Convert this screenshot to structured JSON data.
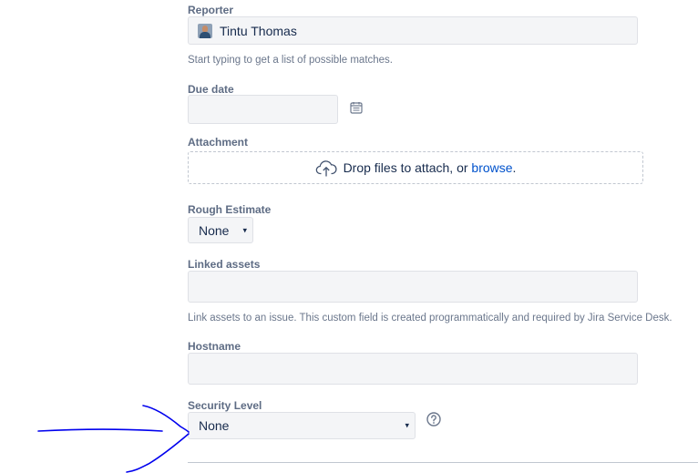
{
  "reporter": {
    "label": "Reporter",
    "value": "Tintu Thomas",
    "help": "Start typing to get a list of possible matches."
  },
  "due_date": {
    "label": "Due date",
    "value": "",
    "icon": "calendar-icon"
  },
  "attachment": {
    "label": "Attachment",
    "drop_text": "Drop files to attach, or ",
    "browse_link": "browse",
    "trailing": ".",
    "icon": "cloud-upload-icon"
  },
  "rough_estimate": {
    "label": "Rough Estimate",
    "value": "None",
    "arrow": "▾"
  },
  "linked_assets": {
    "label": "Linked assets",
    "value": "",
    "help": "Link assets to an issue. This custom field is created programmatically and required by Jira Service Desk."
  },
  "hostname": {
    "label": "Hostname",
    "value": ""
  },
  "security_level": {
    "label": "Security Level",
    "value": "None",
    "arrow": "▾",
    "help_icon": "question-circle-icon"
  },
  "colors": {
    "link": "#0052cc",
    "field_bg": "#f4f5f7",
    "label": "#5e6c84",
    "annotation_ink": "#0000ff"
  }
}
